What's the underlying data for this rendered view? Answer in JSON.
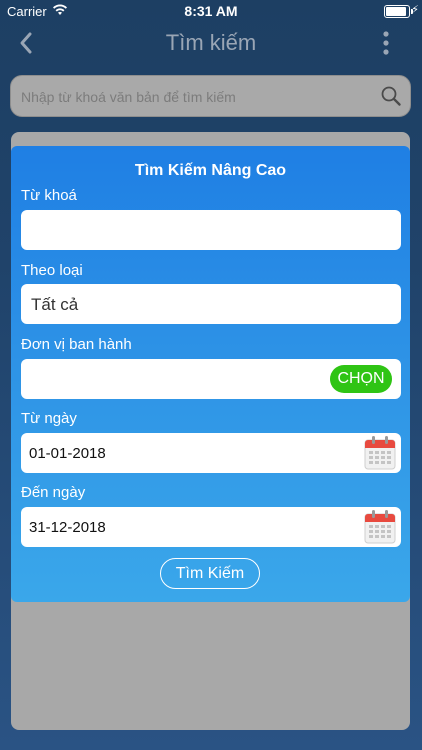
{
  "status_bar": {
    "carrier": "Carrier",
    "time": "8:31 AM",
    "wifi_icon": "wifi-icon",
    "battery_icon": "battery-icon",
    "charging_icon": "bolt-icon"
  },
  "nav": {
    "title": "Tìm kiếm",
    "back_icon": "chevron-left-icon",
    "more_icon": "more-vertical-icon"
  },
  "search": {
    "placeholder": "Nhập từ khoá văn bản để tìm kiếm",
    "icon": "search-icon"
  },
  "modal": {
    "title": "Tìm Kiếm Nâng Cao",
    "keyword": {
      "label": "Từ khoá",
      "value": ""
    },
    "type": {
      "label": "Theo loại",
      "value": "Tất cả"
    },
    "issuer": {
      "label": "Đơn vị ban hành",
      "value": "",
      "button": "CHỌN"
    },
    "from_date": {
      "label": "Từ ngày",
      "value": "01-01-2018",
      "icon": "calendar-icon"
    },
    "to_date": {
      "label": "Đến ngày",
      "value": "31-12-2018",
      "icon": "calendar-icon"
    },
    "submit": "Tìm Kiếm"
  },
  "colors": {
    "background_top": "#1d3f63",
    "modal_top": "#1f7fe4",
    "modal_bottom": "#3aa7ea",
    "choose_button": "#2fc414",
    "calendar_red": "#e84a3f"
  }
}
